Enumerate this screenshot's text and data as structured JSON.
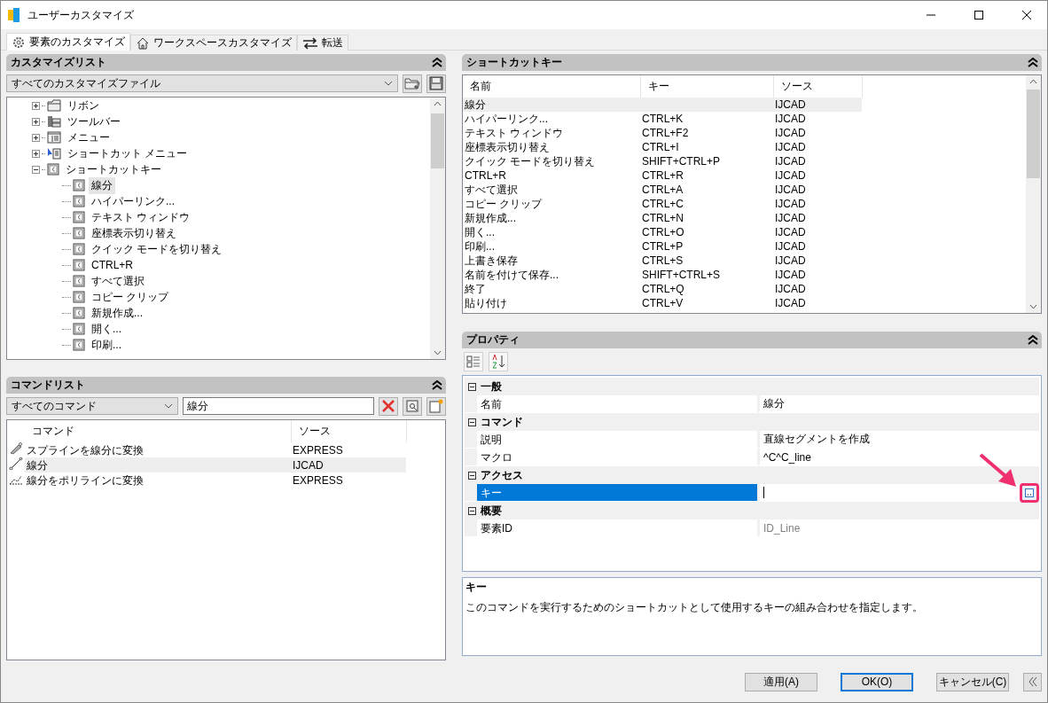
{
  "window": {
    "title": "ユーザーカスタマイズ"
  },
  "tabs": [
    {
      "label": "要素のカスタマイズ",
      "kind": "gear",
      "selected": true
    },
    {
      "label": "ワークスペースカスタマイズ",
      "kind": "house",
      "selected": false
    },
    {
      "label": "転送",
      "kind": "arrows",
      "selected": false
    }
  ],
  "customize_list": {
    "title": "カスタマイズリスト",
    "file_select": "すべてのカスタマイズファイル",
    "tree": [
      {
        "label": "リボン",
        "kind": "ribbon",
        "expanded": false,
        "selected": false
      },
      {
        "label": "ツールバー",
        "kind": "toolbar",
        "expanded": false,
        "selected": false
      },
      {
        "label": "メニュー",
        "kind": "menu",
        "expanded": false,
        "selected": false
      },
      {
        "label": "ショートカット メニュー",
        "kind": "shortcut-menu",
        "expanded": false,
        "selected": false
      },
      {
        "label": "ショートカットキー",
        "kind": "key",
        "expanded": true,
        "selected": false,
        "children": [
          {
            "label": "線分",
            "kind": "key",
            "selected": true
          },
          {
            "label": "ハイパーリンク...",
            "kind": "key",
            "selected": false
          },
          {
            "label": "テキスト ウィンドウ",
            "kind": "key",
            "selected": false
          },
          {
            "label": "座標表示切り替え",
            "kind": "key",
            "selected": false
          },
          {
            "label": "クイック モードを切り替え",
            "kind": "key",
            "selected": false
          },
          {
            "label": "CTRL+R",
            "kind": "key",
            "selected": false
          },
          {
            "label": "すべて選択",
            "kind": "key",
            "selected": false
          },
          {
            "label": "コピー クリップ",
            "kind": "key",
            "selected": false
          },
          {
            "label": "新規作成...",
            "kind": "key",
            "selected": false
          },
          {
            "label": "開く...",
            "kind": "key",
            "selected": false
          },
          {
            "label": "印刷...",
            "kind": "key",
            "selected": false
          }
        ]
      }
    ]
  },
  "command_list": {
    "title": "コマンドリスト",
    "filter": "すべてのコマンド",
    "search": "線分",
    "columns": [
      "コマンド",
      "ソース"
    ],
    "rows": [
      {
        "kind": "spline",
        "command": "スプラインを線分に変換",
        "source": "EXPRESS",
        "selected": false
      },
      {
        "kind": "line",
        "command": "線分",
        "source": "IJCAD",
        "selected": true
      },
      {
        "kind": "polyline",
        "command": "線分をポリラインに変換",
        "source": "EXPRESS",
        "selected": false
      }
    ]
  },
  "shortcut_keys": {
    "title": "ショートカットキー",
    "columns": [
      "名前",
      "キー",
      "ソース"
    ],
    "rows": [
      {
        "name": "線分",
        "source": "IJCAD",
        "selected": true
      },
      {
        "name": "ハイパーリンク...",
        "key": "CTRL+K",
        "source": "IJCAD",
        "selected": false
      },
      {
        "name": "テキスト ウィンドウ",
        "key": "CTRL+F2",
        "source": "IJCAD",
        "selected": false
      },
      {
        "name": "座標表示切り替え",
        "key": "CTRL+I",
        "source": "IJCAD",
        "selected": false
      },
      {
        "name": "クイック モードを切り替え",
        "key": "SHIFT+CTRL+P",
        "source": "IJCAD",
        "selected": false
      },
      {
        "name": "CTRL+R",
        "key": "CTRL+R",
        "source": "IJCAD",
        "selected": false
      },
      {
        "name": "すべて選択",
        "key": "CTRL+A",
        "source": "IJCAD",
        "selected": false
      },
      {
        "name": "コピー クリップ",
        "key": "CTRL+C",
        "source": "IJCAD",
        "selected": false
      },
      {
        "name": "新規作成...",
        "key": "CTRL+N",
        "source": "IJCAD",
        "selected": false
      },
      {
        "name": "開く...",
        "key": "CTRL+O",
        "source": "IJCAD",
        "selected": false
      },
      {
        "name": "印刷...",
        "key": "CTRL+P",
        "source": "IJCAD",
        "selected": false
      },
      {
        "name": "上書き保存",
        "key": "CTRL+S",
        "source": "IJCAD",
        "selected": false
      },
      {
        "name": "名前を付けて保存...",
        "key": "SHIFT+CTRL+S",
        "source": "IJCAD",
        "selected": false
      },
      {
        "name": "終了",
        "key": "CTRL+Q",
        "source": "IJCAD",
        "selected": false
      },
      {
        "name": "貼り付け",
        "key": "CTRL+V",
        "source": "IJCAD",
        "selected": false
      }
    ]
  },
  "properties": {
    "title": "プロパティ",
    "categories": [
      {
        "name": "一般",
        "expanded": true,
        "rows": [
          {
            "name": "名前",
            "value": "線分",
            "selected": false,
            "readonly": false
          }
        ]
      },
      {
        "name": "コマンド",
        "expanded": true,
        "rows": [
          {
            "name": "説明",
            "value": "直線セグメントを作成",
            "selected": false,
            "readonly": false
          },
          {
            "name": "マクロ",
            "value": "^C^C_line",
            "selected": false,
            "readonly": false
          }
        ]
      },
      {
        "name": "アクセス",
        "expanded": true,
        "rows": [
          {
            "name": "キー",
            "selected": true,
            "readonly": false,
            "has_button": true,
            "highlighted": true
          }
        ]
      },
      {
        "name": "概要",
        "expanded": true,
        "rows": [
          {
            "name": "要素ID",
            "value": "ID_Line",
            "selected": false,
            "readonly": true
          }
        ]
      }
    ],
    "description_title": "キー",
    "description": "このコマンドを実行するためのショートカットとして使用するキーの組み合わせを指定します。"
  },
  "buttons": [
    {
      "label": "適用(A)",
      "default": false
    },
    {
      "label": "OK(O)",
      "default": true
    },
    {
      "label": "キャンセル(C)",
      "default": false
    }
  ]
}
